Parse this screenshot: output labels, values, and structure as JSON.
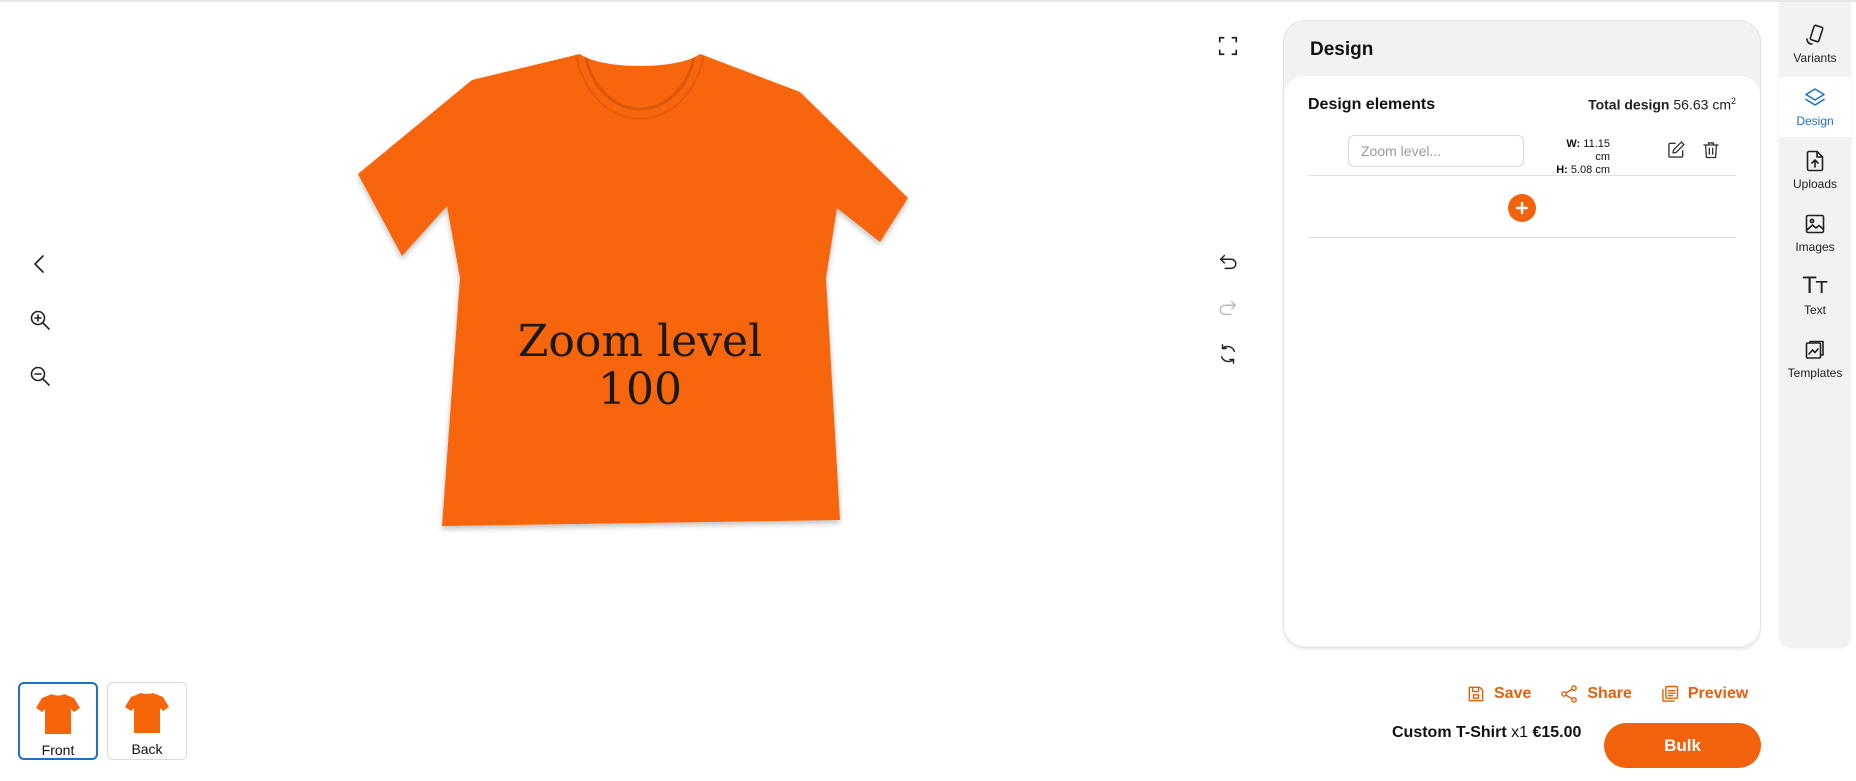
{
  "canvas": {
    "design_text_line1": "Zoom level",
    "design_text_line2": "100",
    "shirt_color": "#f7650b"
  },
  "left_tools": {
    "icons": [
      "chevron-left-icon",
      "zoom-in-icon",
      "zoom-out-icon"
    ]
  },
  "canvas_tools": {
    "icons": [
      "fullscreen-icon",
      "undo-icon",
      "redo-icon",
      "rotate-icon"
    ]
  },
  "design_panel": {
    "title": "Design",
    "elements_header": "Design elements",
    "total_label": "Total design",
    "total_value": "56.63 cm",
    "total_unit_sup": "2",
    "element": {
      "input_placeholder": "Zoom level...",
      "width_label": "W:",
      "width_value": "11.15 cm",
      "height_label": "H:",
      "height_value": "5.08 cm"
    }
  },
  "sidebar": {
    "items": [
      {
        "label": "Variants",
        "icon": "phone-rotate-icon"
      },
      {
        "label": "Design",
        "icon": "layers-icon",
        "active": true
      },
      {
        "label": "Uploads",
        "icon": "upload-file-icon"
      },
      {
        "label": "Images",
        "icon": "image-icon"
      },
      {
        "label": "Text",
        "icon": "text-icon",
        "glyph": "Tт"
      },
      {
        "label": "Templates",
        "icon": "templates-icon"
      }
    ]
  },
  "views": [
    {
      "label": "Front",
      "active": true
    },
    {
      "label": "Back",
      "active": false
    }
  ],
  "actions": {
    "save": "Save",
    "share": "Share",
    "preview": "Preview"
  },
  "order": {
    "product": "Custom T-Shirt",
    "quantity": "x1",
    "price": "€15.00",
    "bulk": "Bulk"
  },
  "colors": {
    "accent": "#f2620c",
    "active_blue": "#1f6fc4"
  }
}
